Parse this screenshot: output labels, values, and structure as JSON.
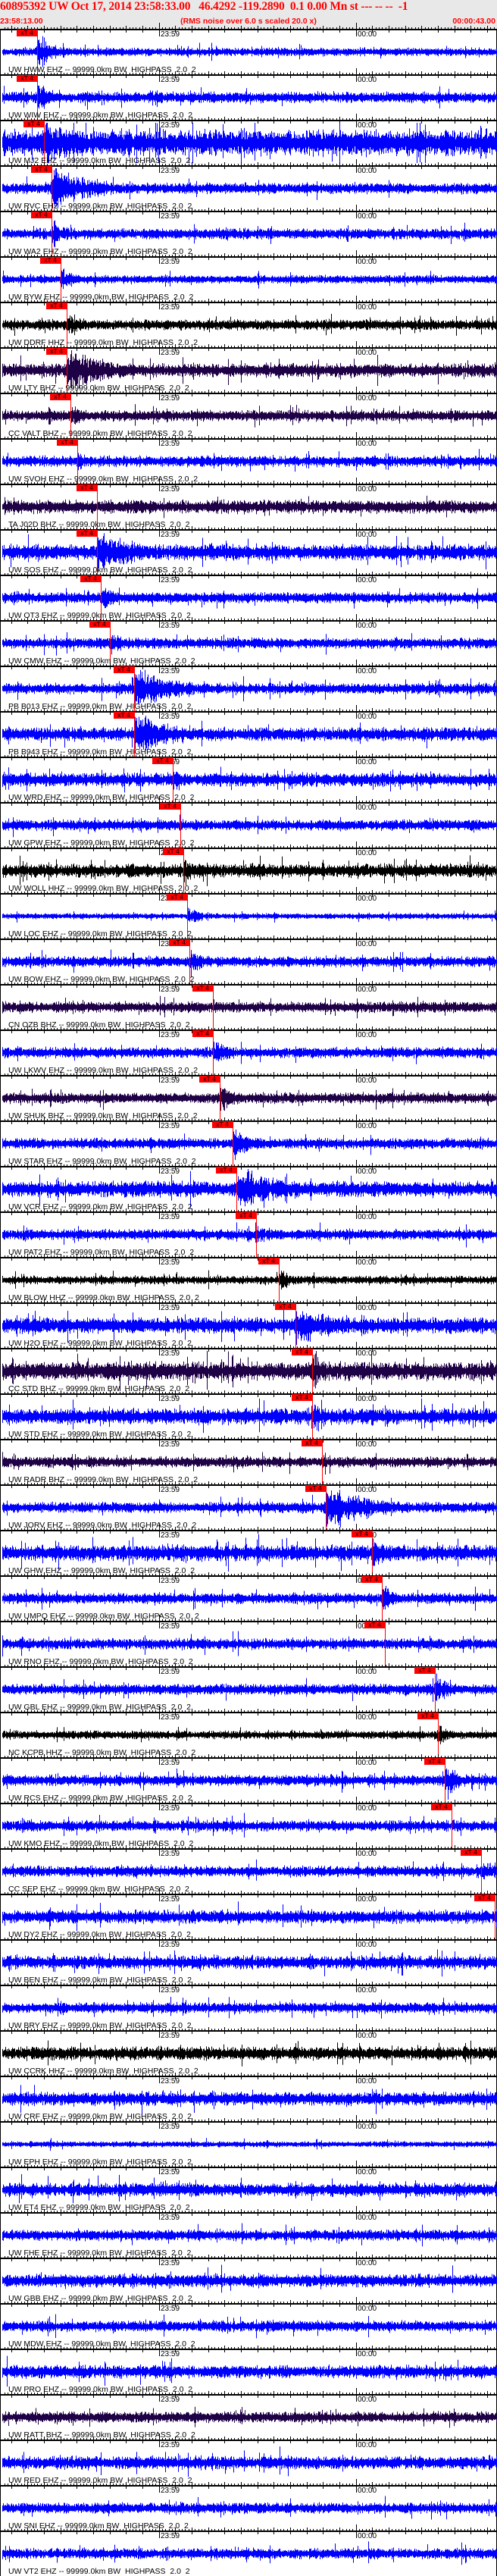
{
  "header": {
    "title": "60895392 UW Oct 17, 2014 23:58:33.00   46.4292 -119.2890  0.1 0.00 Mn st --- -- --  -1",
    "start_time": "23:58:13.00",
    "note": "(RMS noise over 6.0 s scaled 20.0 x)",
    "end_time": "00:00:43.00"
  },
  "chart_data": {
    "type": "line",
    "title": "60895392 UW Oct 17, 2014 23:58:33.00",
    "x_units": "seconds after 23:58:13",
    "xlim": [
      0,
      150
    ],
    "minute_marks": [
      {
        "t": 47,
        "label": "23:59"
      },
      {
        "t": 107,
        "label": "00:00"
      }
    ],
    "pick_label": "xT 4",
    "filter_suffix": "-- 99999.0km BW  HIGHPASS  2.0  2",
    "channel_colors": {
      "EHZ": "#0000ff",
      "HHZ": "#000000",
      "BHZ": "#1e0046"
    },
    "pick_color": "#ff0000",
    "traces": [
      {
        "label": "UW HWW EHZ",
        "ch": "EHZ",
        "pick_s": 9.9,
        "noise": 0.15,
        "event": 0.8
      },
      {
        "label": "UW WIW EHZ",
        "ch": "EHZ",
        "pick_s": 9.9,
        "noise": 0.2,
        "event": 0.7
      },
      {
        "label": "UW MJ2 EHZ",
        "ch": "EHZ",
        "pick_s": 12.0,
        "noise": 0.5,
        "event": 1.0
      },
      {
        "label": "UW RVC EHZ",
        "ch": "EHZ",
        "pick_s": 14.3,
        "noise": 0.2,
        "event": 0.9
      },
      {
        "label": "UW WA2 EHZ",
        "ch": "EHZ",
        "pick_s": 14.3,
        "noise": 0.2,
        "event": 0.6
      },
      {
        "label": "UW BYW EHZ",
        "ch": "EHZ",
        "pick_s": 17.1,
        "noise": 0.15,
        "event": 0.5
      },
      {
        "label": "UW DDRF HHZ",
        "ch": "HHZ",
        "pick_s": 18.9,
        "noise": 0.2,
        "event": 0.6
      },
      {
        "label": "UW LTY BHZ",
        "ch": "BHZ",
        "pick_s": 18.9,
        "noise": 0.25,
        "event": 0.9
      },
      {
        "label": "CC VALT BHZ",
        "ch": "BHZ",
        "pick_s": 20.1,
        "noise": 0.2,
        "event": 0.5
      },
      {
        "label": "UW SVOH EHZ",
        "ch": "EHZ",
        "pick_s": 22.2,
        "noise": 0.2,
        "event": 0.4
      },
      {
        "label": "TA J02D BHZ",
        "ch": "BHZ",
        "pick_s": 28.2,
        "noise": 0.25,
        "event": 0.3
      },
      {
        "label": "UW SOS EHZ",
        "ch": "EHZ",
        "pick_s": 28.2,
        "noise": 0.3,
        "event": 0.9
      },
      {
        "label": "UW OT3 EHZ",
        "ch": "EHZ",
        "pick_s": 29.3,
        "noise": 0.2,
        "event": 0.6
      },
      {
        "label": "UW CMW EHZ",
        "ch": "EHZ",
        "pick_s": 32.1,
        "noise": 0.2,
        "event": 0.5
      },
      {
        "label": "PB B013 EHZ",
        "ch": "EHZ",
        "pick_s": 39.5,
        "noise": 0.2,
        "event": 0.9
      },
      {
        "label": "PB B943 EHZ",
        "ch": "EHZ",
        "pick_s": 39.5,
        "noise": 0.25,
        "event": 0.9
      },
      {
        "label": "UW WRD EHZ",
        "ch": "EHZ",
        "pick_s": 51.2,
        "noise": 0.25,
        "event": 0.6
      },
      {
        "label": "UW GPW EHZ",
        "ch": "EHZ",
        "pick_s": 53.5,
        "noise": 0.2,
        "event": 0.3
      },
      {
        "label": "UW WOLL HHZ",
        "ch": "HHZ",
        "pick_s": 54.5,
        "noise": 0.25,
        "event": 0.6
      },
      {
        "label": "UW LOC EHZ",
        "ch": "EHZ",
        "pick_s": 55.6,
        "noise": 0.1,
        "event": 0.4
      },
      {
        "label": "UW BOW EHZ",
        "ch": "EHZ",
        "pick_s": 56.3,
        "noise": 0.2,
        "event": 0.6
      },
      {
        "label": "CN OZB BHZ",
        "ch": "BHZ",
        "pick_s": 63.5,
        "noise": 0.2,
        "event": 0.3
      },
      {
        "label": "UW LKWV EHZ",
        "ch": "EHZ",
        "pick_s": 63.5,
        "noise": 0.2,
        "event": 0.6
      },
      {
        "label": "UW SHUK BHZ",
        "ch": "BHZ",
        "pick_s": 65.5,
        "noise": 0.2,
        "event": 0.7
      },
      {
        "label": "UW STAR EHZ",
        "ch": "EHZ",
        "pick_s": 69.5,
        "noise": 0.2,
        "event": 0.8
      },
      {
        "label": "UW VCR EHZ",
        "ch": "EHZ",
        "pick_s": 70.6,
        "noise": 0.3,
        "event": 1.0
      },
      {
        "label": "UW PAT2 EHZ",
        "ch": "EHZ",
        "pick_s": 76.6,
        "noise": 0.2,
        "event": 0.4
      },
      {
        "label": "UW BLOW HHZ",
        "ch": "HHZ",
        "pick_s": 83.5,
        "noise": 0.15,
        "event": 0.5
      },
      {
        "label": "UW H2O EHZ",
        "ch": "EHZ",
        "pick_s": 88.6,
        "noise": 0.3,
        "event": 0.9
      },
      {
        "label": "CC STD BHZ",
        "ch": "BHZ",
        "pick_s": 93.7,
        "noise": 0.35,
        "event": 0.8
      },
      {
        "label": "UW STD EHZ",
        "ch": "EHZ",
        "pick_s": 93.7,
        "noise": 0.3,
        "event": 0.8
      },
      {
        "label": "UW RADR BHZ",
        "ch": "BHZ",
        "pick_s": 96.7,
        "noise": 0.2,
        "event": 0.3
      },
      {
        "label": "UW JORV EHZ",
        "ch": "EHZ",
        "pick_s": 97.9,
        "noise": 0.2,
        "event": 1.0
      },
      {
        "label": "UW GHW EHZ",
        "ch": "EHZ",
        "pick_s": 111.9,
        "noise": 0.3,
        "event": 0.7
      },
      {
        "label": "UW UMPQ EHZ",
        "ch": "EHZ",
        "pick_s": 114.9,
        "noise": 0.2,
        "event": 0.6
      },
      {
        "label": "UW RNO EHZ",
        "ch": "EHZ",
        "pick_s": 115.9,
        "noise": 0.2,
        "event": 0.3
      },
      {
        "label": "UW GBL EHZ",
        "ch": "EHZ",
        "pick_s": 131.1,
        "noise": 0.2,
        "event": 0.7
      },
      {
        "label": "NC KCPB HHZ",
        "ch": "HHZ",
        "pick_s": 132.0,
        "noise": 0.15,
        "event": 0.4
      },
      {
        "label": "UW RCS EHZ",
        "ch": "EHZ",
        "pick_s": 134.1,
        "noise": 0.2,
        "event": 0.8
      },
      {
        "label": "UW KMO EHZ",
        "ch": "EHZ",
        "pick_s": 136.2,
        "noise": 0.2,
        "event": 0.3
      },
      {
        "label": "CC SEP EHZ",
        "ch": "EHZ",
        "pick_s": 145.2,
        "noise": 0.2,
        "event": 0.5
      },
      {
        "label": "UW DY2 EHZ",
        "ch": "EHZ",
        "pick_s": 149.3,
        "noise": 0.25,
        "event": 0.6
      },
      {
        "label": "UW BEN EHZ",
        "ch": "EHZ",
        "pick_s": null,
        "noise": 0.25,
        "event": 0
      },
      {
        "label": "UW BRY EHZ",
        "ch": "EHZ",
        "pick_s": null,
        "noise": 0.2,
        "event": 0
      },
      {
        "label": "UW CCRK HHZ",
        "ch": "HHZ",
        "pick_s": null,
        "noise": 0.25,
        "event": 0
      },
      {
        "label": "UW CRF EHZ",
        "ch": "EHZ",
        "pick_s": null,
        "noise": 0.25,
        "event": 0
      },
      {
        "label": "UW EPH EHZ",
        "ch": "EHZ",
        "pick_s": null,
        "noise": 0.1,
        "event": 0
      },
      {
        "label": "UW ET4 EHZ",
        "ch": "EHZ",
        "pick_s": null,
        "noise": 0.25,
        "event": 0
      },
      {
        "label": "UW FHE EHZ",
        "ch": "EHZ",
        "pick_s": null,
        "noise": 0.2,
        "event": 0
      },
      {
        "label": "UW GBB EHZ",
        "ch": "EHZ",
        "pick_s": null,
        "noise": 0.25,
        "event": 0
      },
      {
        "label": "UW MDW EHZ",
        "ch": "EHZ",
        "pick_s": null,
        "noise": 0.2,
        "event": 0
      },
      {
        "label": "UW PRO EHZ",
        "ch": "EHZ",
        "pick_s": null,
        "noise": 0.25,
        "event": 0
      },
      {
        "label": "UW RATT BHZ",
        "ch": "BHZ",
        "pick_s": null,
        "noise": 0.2,
        "event": 0
      },
      {
        "label": "UW RED EHZ",
        "ch": "EHZ",
        "pick_s": null,
        "noise": 0.25,
        "event": 0
      },
      {
        "label": "UW SNI EHZ",
        "ch": "EHZ",
        "pick_s": null,
        "noise": 0.2,
        "event": 0
      },
      {
        "label": "UW VT2 EHZ",
        "ch": "EHZ",
        "pick_s": null,
        "noise": 0.2,
        "event": 0
      }
    ]
  }
}
